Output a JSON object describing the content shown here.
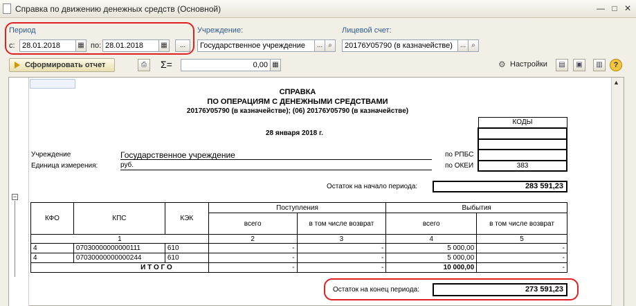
{
  "window": {
    "title": "Справка по движению денежных средств (Основной)"
  },
  "toolbar": {
    "period_label": "Период",
    "from_label": "с:",
    "from_value": "28.01.2018",
    "to_label": "по:",
    "to_value": "28.01.2018",
    "ellipsis": "...",
    "institution_label": "Учреждение:",
    "institution_value": "Государственное учреждение",
    "account_label": "Лицевой счет:",
    "account_value": "20176У05790 (в казначействе)",
    "generate_label": "Сформировать отчет",
    "sum_symbol": "Σ=",
    "sum_value": "0,00",
    "settings_label": "Настройки"
  },
  "report": {
    "title1": "СПРАВКА",
    "title2": "ПО ОПЕРАЦИЯМ С ДЕНЕЖНЫМИ СРЕДСТВАМИ",
    "title3": "20176У05790 (в казначействе); (06) 20176У05790 (в казначействе)",
    "date": "28 января 2018 г.",
    "codes_header": "КОДЫ",
    "institution_label": "Учреждение",
    "institution_value": "Государственное учреждение",
    "unit_label": "Единица измерения:",
    "unit_value": "руб.",
    "rpbs_label": "по РПБС",
    "okei_label": "по ОКЕИ",
    "okei_value": "383",
    "start_balance_label": "Остаток на начало периода:",
    "start_balance_value": "283 591,23",
    "end_balance_label": "Остаток на конец периода:",
    "end_balance_value": "273 591,23",
    "headers": {
      "kfo": "КФО",
      "kps": "КПС",
      "kek": "КЭК",
      "income": "Поступления",
      "outgo": "Выбытия",
      "total": "всего",
      "incl_return": "в том числе возврат"
    },
    "col_numbers": [
      "1",
      "2",
      "3",
      "4",
      "5"
    ],
    "rows": [
      {
        "kfo": "4",
        "kps": "07030000000000111",
        "kek": "610",
        "in_total": "-",
        "in_return": "-",
        "out_total": "5 000,00",
        "out_return": "-"
      },
      {
        "kfo": "4",
        "kps": "07030000000000244",
        "kek": "610",
        "in_total": "-",
        "in_return": "-",
        "out_total": "5 000,00",
        "out_return": "-"
      }
    ],
    "total_row": {
      "label": "И Т О Г О",
      "in_total": "-",
      "in_return": "-",
      "out_total": "10 000,00",
      "out_return": "-"
    }
  }
}
